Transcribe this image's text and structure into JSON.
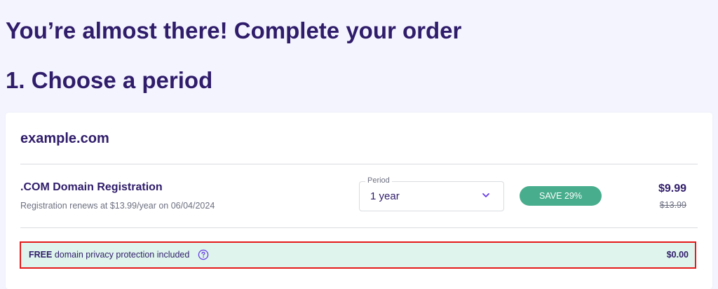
{
  "page": {
    "title": "You’re almost there! Complete your order",
    "step_heading": "1. Choose a period"
  },
  "order": {
    "domain": "example.com",
    "product": {
      "title": ".COM Domain Registration",
      "renewal_note": "Registration renews at $13.99/year on 06/04/2024"
    },
    "period": {
      "label": "Period",
      "selected": "1 year",
      "icon": "chevron-down-icon"
    },
    "save_badge": "SAVE 29%",
    "price": {
      "current": "$9.99",
      "original": "$13.99"
    },
    "privacy": {
      "free_label": "FREE",
      "text": "domain privacy protection included",
      "help_icon": "question-circle-icon",
      "price": "$0.00"
    }
  },
  "colors": {
    "page_bg": "#f4f4fe",
    "heading": "#2f1c6a",
    "save_badge_bg": "#47ad8c",
    "privacy_bg": "#def4ec",
    "highlight_border": "#e41a1a",
    "accent": "#673de6"
  }
}
